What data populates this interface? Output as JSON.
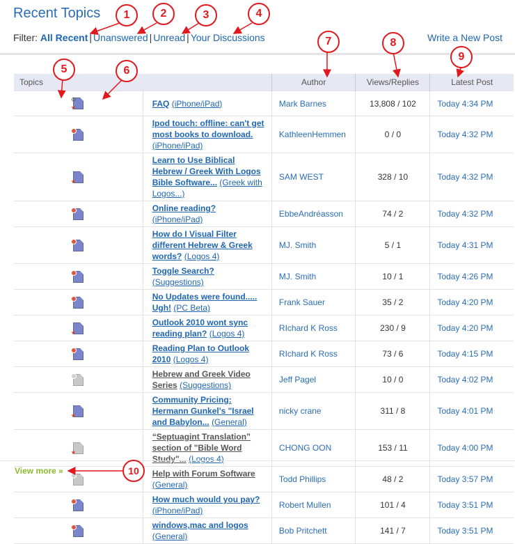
{
  "header": {
    "title": "Recent Topics",
    "filter_label": "Filter:",
    "filters": [
      "All Recent",
      "Unanswered",
      "Unread",
      "Your Discussions"
    ],
    "write_post": "Write a New Post"
  },
  "table": {
    "columns": [
      "Topics",
      "Author",
      "Views/Replies",
      "Latest Post"
    ],
    "rows": [
      {
        "title": "FAQ",
        "category": "(iPhone/iPad)",
        "author": "Mark Barnes",
        "views": "13,808 / 102",
        "latest": "Today 4:34 PM"
      },
      {
        "title": "Ipod touch: offline: can't get most books to download.",
        "category": "(iPhone/iPad)",
        "author": "KathleenHemmen",
        "views": "0 / 0",
        "latest": "Today 4:32 PM"
      },
      {
        "title": "Learn to Use Biblical Hebrew / Greek With Logos Bible Software...",
        "category": "(Greek with Logos...)",
        "author": "SAM WEST",
        "views": "328 / 10",
        "latest": "Today 4:32 PM"
      },
      {
        "title": "Online reading?",
        "category": "(iPhone/iPad)",
        "author": "EbbeAndréasson",
        "views": "74 / 2",
        "latest": "Today 4:32 PM"
      },
      {
        "title": "How do I Visual Filter different Hebrew & Greek words?",
        "category": "(Logos 4)",
        "author": "MJ. Smith",
        "views": "5 / 1",
        "latest": "Today 4:31 PM"
      },
      {
        "title": "Toggle Search?",
        "category": "(Suggestions)",
        "author": "MJ. Smith",
        "views": "10 / 1",
        "latest": "Today 4:26 PM"
      },
      {
        "title": "No Updates were found..... Ugh!",
        "category": "(PC Beta)",
        "author": "Frank Sauer",
        "views": "35 / 2",
        "latest": "Today 4:20 PM"
      },
      {
        "title": "Outlook 2010 wont sync reading plan?",
        "category": "(Logos 4)",
        "author": "RIchard K Ross",
        "views": "230 / 9",
        "latest": "Today 4:20 PM"
      },
      {
        "title": "Reading Plan to Outlook 2010",
        "category": "(Logos 4)",
        "author": "RIchard K Ross",
        "views": "73 / 6",
        "latest": "Today 4:15 PM"
      },
      {
        "title": "Hebrew and Greek Video Series",
        "category": "(Suggestions)",
        "author": "Jeff Pagel",
        "views": "10 / 0",
        "latest": "Today 4:02 PM"
      },
      {
        "title": "Community Pricing: Hermann Gunkel's \"Israel and Babylon...",
        "category": "(General)",
        "author": "nicky crane",
        "views": "311 / 8",
        "latest": "Today 4:01 PM"
      },
      {
        "title": "“Septuagint Translation” section of \"Bible Word Study\"...",
        "category": "(Logos 4)",
        "author": "CHONG OON",
        "views": "153 / 11",
        "latest": "Today 4:00 PM"
      },
      {
        "title": "Help with Forum Software",
        "category": "(General)",
        "author": "Todd Phillips",
        "views": "48 / 2",
        "latest": "Today 3:57 PM"
      },
      {
        "title": "How much would you pay?",
        "category": "(iPhone/iPad)",
        "author": "Robert Mullen",
        "views": "101 / 4",
        "latest": "Today 3:51 PM"
      },
      {
        "title": "windows,mac and logos",
        "category": "(General)",
        "author": "Bob Pritchett",
        "views": "141 / 7",
        "latest": "Today 3:51 PM"
      }
    ]
  },
  "footer": {
    "view_more": "View more »"
  },
  "callouts": [
    "1",
    "2",
    "3",
    "4",
    "5",
    "6",
    "7",
    "8",
    "9",
    "10"
  ],
  "colors": {
    "link": "#1f66b3",
    "header_bg": "#e6e9f4",
    "callout": "#e0191f",
    "view_more": "#8bbb2c"
  }
}
